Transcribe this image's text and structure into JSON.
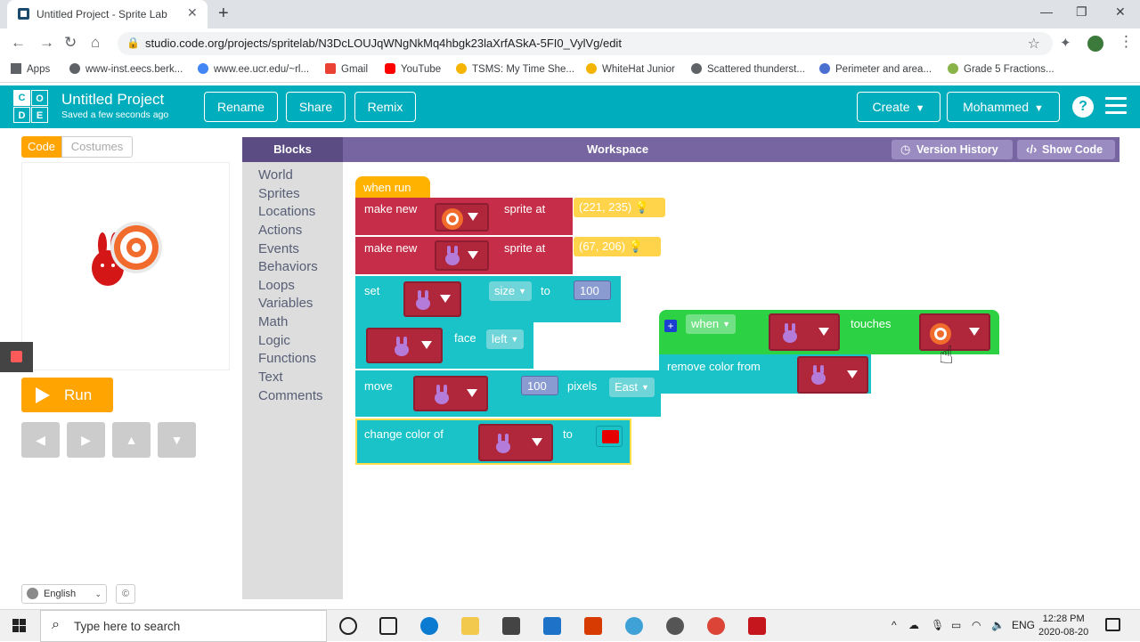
{
  "browser": {
    "tab_title": "Untitled Project - Sprite Lab",
    "url": "studio.code.org/projects/spritelab/N3DcLOUJqWNgNkMq4hbgk23laXrfASkA-5FI0_VylVg/edit",
    "bookmarks": [
      "Apps",
      "www-inst.eecs.berk...",
      "www.ee.ucr.edu/~rl...",
      "Gmail",
      "YouTube",
      "TSMS: My Time She...",
      "WhiteHat Junior",
      "Scattered thunderst...",
      "Perimeter and area...",
      "Grade 5 Fractions..."
    ]
  },
  "app": {
    "logo": [
      "C",
      "O",
      "D",
      "E"
    ],
    "project_title": "Untitled Project",
    "saved_status": "Saved a few seconds ago",
    "rename_label": "Rename",
    "share_label": "Share",
    "remix_label": "Remix",
    "create_label": "Create",
    "user_label": "Mohammed",
    "help_label": "?"
  },
  "left_panel": {
    "code_tab": "Code",
    "costumes_tab": "Costumes",
    "run_label": "Run",
    "language": "English",
    "cc_label": "©"
  },
  "workspace": {
    "blocks_header": "Blocks",
    "title": "Workspace",
    "version_history": "Version History",
    "show_code": "Show Code",
    "categories": [
      "World",
      "Sprites",
      "Locations",
      "Actions",
      "Events",
      "Behaviors",
      "Loops",
      "Variables",
      "Math",
      "Logic",
      "Functions",
      "Text",
      "Comments"
    ]
  },
  "blocks": {
    "when_run": "when run",
    "make_new_1": "make new",
    "sprite_at_1": "sprite at",
    "location_1": "(221, 235)",
    "make_new_2": "make new",
    "sprite_at_2": "sprite at",
    "location_2": "(67, 206)",
    "set": "set",
    "size": "size",
    "to_1": "to",
    "size_value": "100",
    "face": "face",
    "direction": "left",
    "move": "move",
    "move_value": "100",
    "pixels": "pixels",
    "move_dir": "East",
    "change_color_of": "change color of",
    "to_2": "to",
    "color_value": "#e60000",
    "when": "when",
    "touches": "touches",
    "remove_color_from": "remove color from",
    "plus": "+"
  },
  "taskbar": {
    "search_placeholder": "Type here to search",
    "lang": "ENG",
    "time": "12:28 PM",
    "date": "2020-08-20"
  },
  "colors": {
    "header_teal": "#00adbc",
    "orange": "#ffa400",
    "block_teal": "#19c3c8",
    "block_red": "#c62d48",
    "event_yellow": "#ffd34a",
    "event_green": "#2cd244",
    "purple": "#7665a0"
  }
}
